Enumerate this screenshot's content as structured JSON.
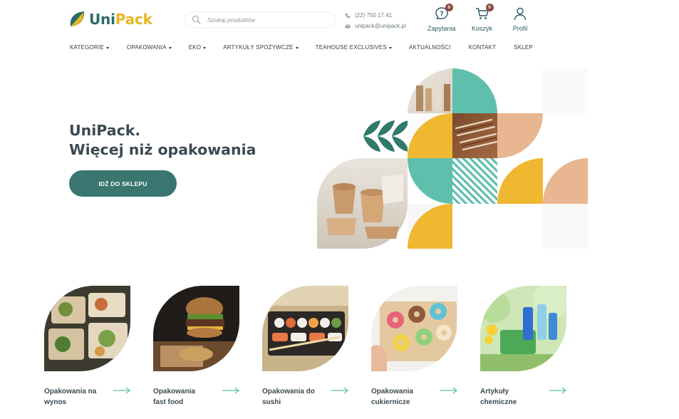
{
  "brand": {
    "part1": "Uni",
    "part2": "Pack"
  },
  "search": {
    "placeholder": "Szukaj produktów"
  },
  "contact": {
    "phone": "(22) 750 17 41",
    "email": "unipack@unipack.pl"
  },
  "actions": {
    "inquiries": {
      "label": "Zapytania",
      "count": "0"
    },
    "cart": {
      "label": "Koszyk",
      "count": "0"
    },
    "profile": {
      "label": "Profil"
    }
  },
  "nav": [
    {
      "label": "KATEGORIE",
      "dropdown": true
    },
    {
      "label": "OPAKOWANIA",
      "dropdown": true
    },
    {
      "label": "EKO",
      "dropdown": true
    },
    {
      "label": "ARTYKUŁY SPOŻYWCZE",
      "dropdown": true
    },
    {
      "label": "TEAHOUSE EXCLUSIVES",
      "dropdown": true
    },
    {
      "label": "AKTUALNOŚCI",
      "dropdown": false
    },
    {
      "label": "KONTAKT",
      "dropdown": false
    },
    {
      "label": "SKLEP",
      "dropdown": false
    }
  ],
  "hero": {
    "line1": "UniPack.",
    "line2": "Więcej niż opakowania",
    "cta": "IDŹ DO SKLEPU"
  },
  "categories": [
    {
      "line1": "Opakowania na",
      "line2": "wynos"
    },
    {
      "line1": "Opakowania",
      "line2": "fast food"
    },
    {
      "line1": "Opakowania do",
      "line2": "sushi"
    },
    {
      "line1": "Opakowania",
      "line2": "cukiernicze"
    },
    {
      "line1": "Artykuły",
      "line2": "chemiczne"
    }
  ],
  "colors": {
    "primary": "#3a7570",
    "accent_yellow": "#f0b731",
    "teal": "#5ebfad",
    "peach": "#e8b690",
    "badge": "#8b4b3c"
  }
}
